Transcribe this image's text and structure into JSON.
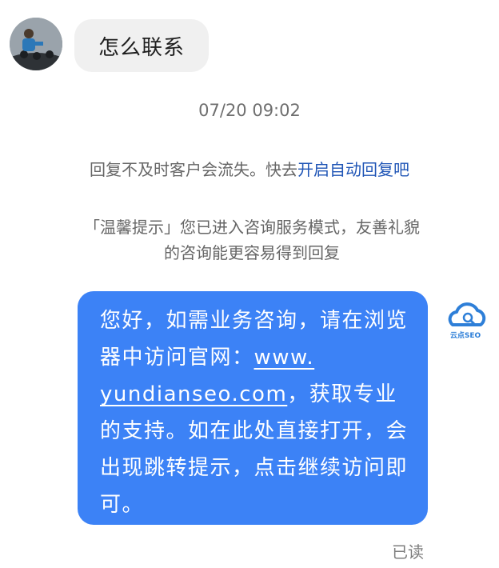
{
  "incoming": {
    "text": "怎么联系"
  },
  "timestamp": "07/20 09:02",
  "notice": {
    "text": "回复不及时客户会流失。快去",
    "link": "开启自动回复吧"
  },
  "tip": {
    "line1": "「温馨提示」您已进入咨询服务模式，友善礼貌",
    "line2": "的咨询能更容易得到回复"
  },
  "outgoing": {
    "part1": "您好，如需业务咨询，请在浏览器中访问官网：",
    "url_line1": "www.",
    "url_line2": "yundianseo.com",
    "part2": "，获取专业的支持。如在此处直接打开，会出现跳转提示，点击继续访问即可。"
  },
  "brand_logo_text": "云点SEO",
  "status": "已读",
  "colors": {
    "bubble_out": "#3c82f6",
    "bubble_in": "#f0f0f0",
    "link": "#1f55b6"
  }
}
